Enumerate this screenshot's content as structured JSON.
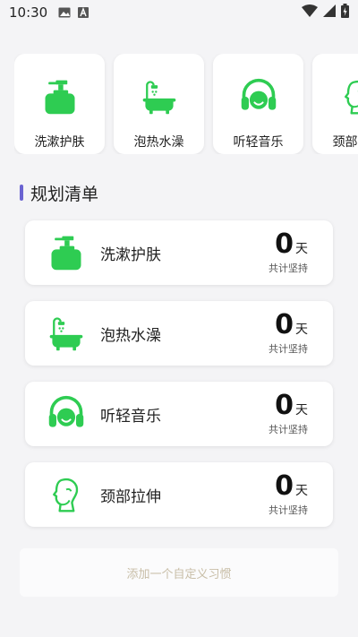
{
  "status_bar": {
    "time": "10:30",
    "icons": [
      "image-icon",
      "a-box-icon",
      "wifi-icon",
      "signal-icon",
      "battery-charging-icon"
    ]
  },
  "categories": [
    {
      "label": "洗漱护肤",
      "icon": "lotion-bottle-icon"
    },
    {
      "label": "泡热水澡",
      "icon": "bathtub-icon"
    },
    {
      "label": "听轻音乐",
      "icon": "headphones-icon"
    },
    {
      "label": "颈部拉伸",
      "icon": "neck-stretch-icon"
    }
  ],
  "section": {
    "title": "规划清单"
  },
  "plans": [
    {
      "name": "洗漱护肤",
      "count": "0",
      "unit": "天",
      "sub": "共计坚持",
      "icon": "lotion-bottle-icon"
    },
    {
      "name": "泡热水澡",
      "count": "0",
      "unit": "天",
      "sub": "共计坚持",
      "icon": "bathtub-icon"
    },
    {
      "name": "听轻音乐",
      "count": "0",
      "unit": "天",
      "sub": "共计坚持",
      "icon": "headphones-icon"
    },
    {
      "name": "颈部拉伸",
      "count": "0",
      "unit": "天",
      "sub": "共计坚持",
      "icon": "neck-stretch-icon"
    }
  ],
  "add_button": {
    "label": "添加一个自定义习惯"
  },
  "colors": {
    "accent_green": "#2ecc52",
    "section_bar": "#6a63d1",
    "add_text": "#c8bea7"
  }
}
